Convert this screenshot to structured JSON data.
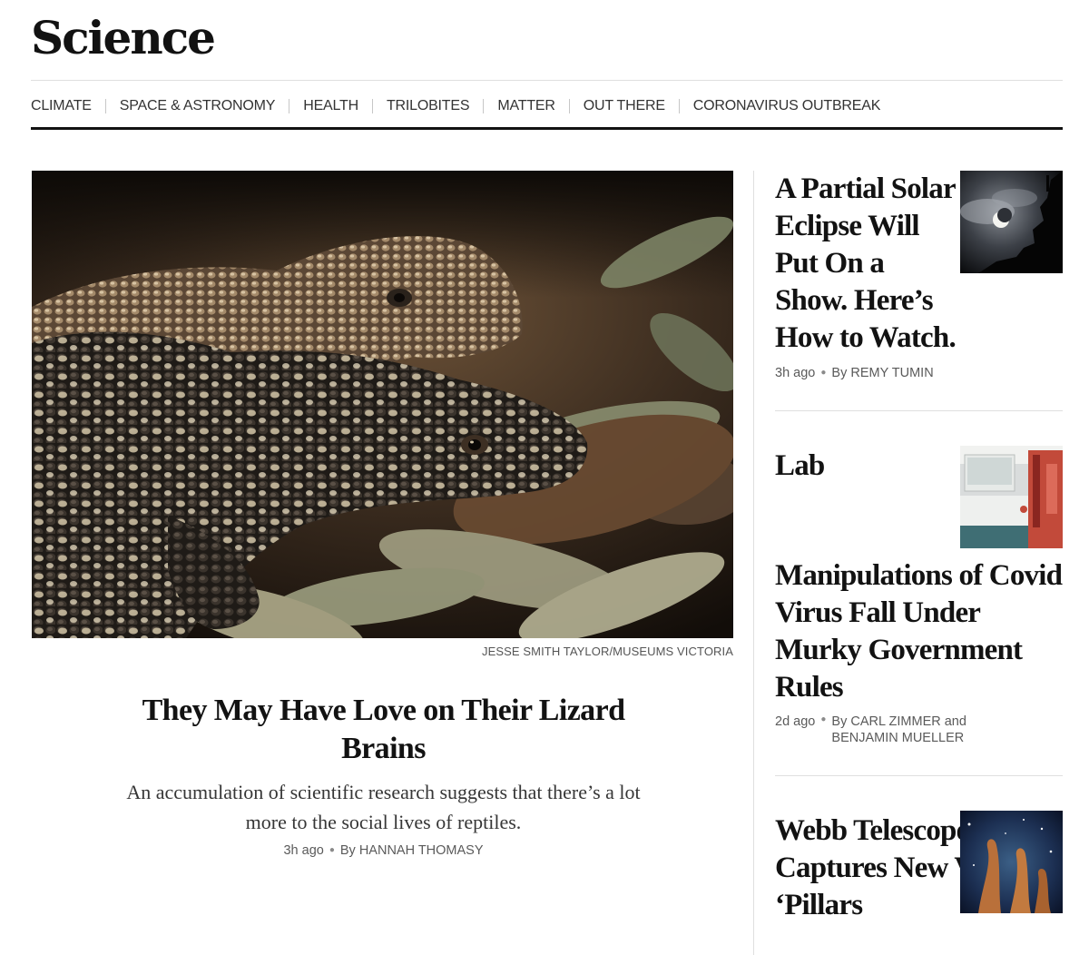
{
  "section": {
    "title": "Science"
  },
  "nav": {
    "items": [
      {
        "label": "CLIMATE"
      },
      {
        "label": "SPACE & ASTRONOMY"
      },
      {
        "label": "HEALTH"
      },
      {
        "label": "TRILOBITES"
      },
      {
        "label": "MATTER"
      },
      {
        "label": "OUT THERE"
      },
      {
        "label": "CORONAVIRUS OUTBREAK"
      }
    ]
  },
  "lead": {
    "image_credit": "JESSE SMITH TAYLOR/MUSEUMS VICTORIA",
    "headline": "They May Have Love on Their Lizard Brains",
    "summary": "An accumulation of scientific research suggests that there’s a lot more to the social lives of reptiles.",
    "time": "3h ago",
    "byline": "By HANNAH THOMASY"
  },
  "side": [
    {
      "headline": "A Partial Solar Eclipse Will Put On a Show. Here’s How to Watch.",
      "time": "3h ago",
      "byline": "By REMY TUMIN"
    },
    {
      "headline_top": "Lab",
      "headline": "Manipulations of Covid Virus Fall Under Murky Government Rules",
      "time": "2d ago",
      "byline": "By CARL ZIMMER and BENJAMIN MUELLER"
    },
    {
      "headline": "Webb Telescope Captures New View of ‘Pillars"
    }
  ],
  "colors": {
    "text": "#121212",
    "rule": "#dfdfdf",
    "byline": "#5a5a5a"
  }
}
